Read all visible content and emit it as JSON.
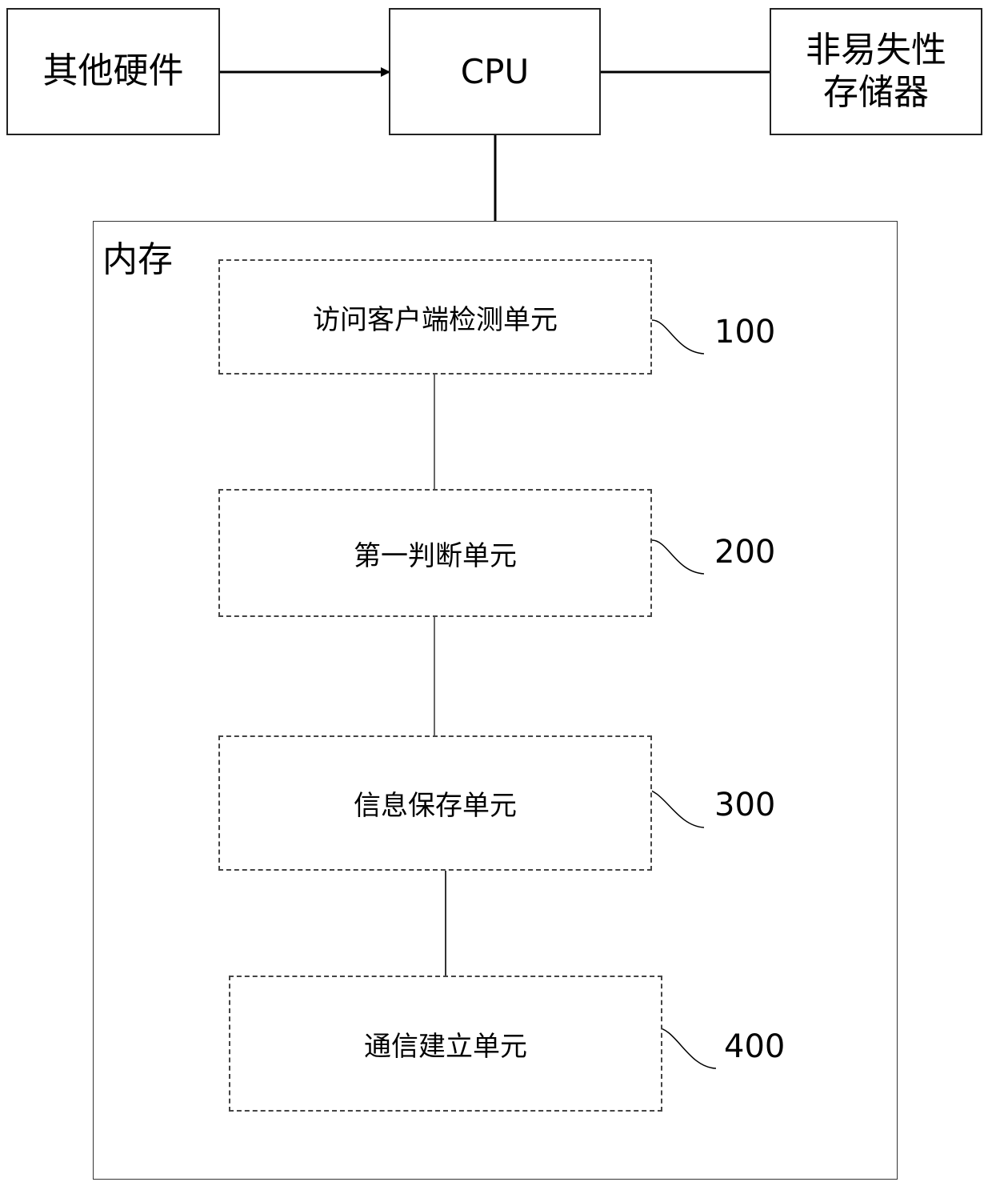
{
  "top": {
    "other_hardware": "其他硬件",
    "cpu": "CPU",
    "nonvolatile_storage_line1": "非易失性",
    "nonvolatile_storage_line2": "存储器"
  },
  "memory": {
    "label": "内存",
    "units": [
      {
        "label": "访问客户端检测单元",
        "ref": "100"
      },
      {
        "label": "第一判断单元",
        "ref": "200"
      },
      {
        "label": "信息保存单元",
        "ref": "300"
      },
      {
        "label": "通信建立单元",
        "ref": "400"
      }
    ]
  }
}
